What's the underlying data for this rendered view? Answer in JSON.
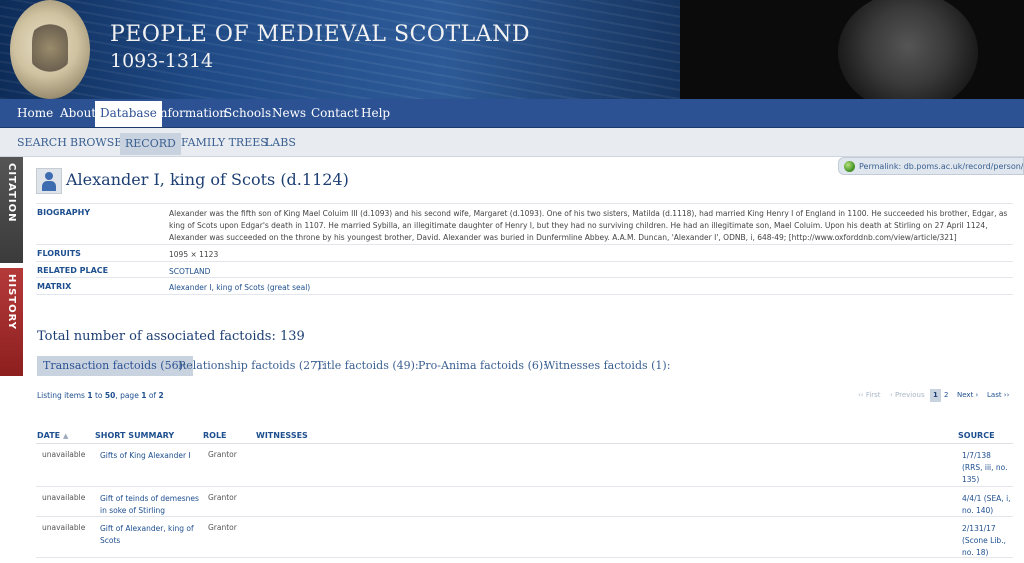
{
  "header": {
    "site_title": "PEOPLE OF MEDIEVAL SCOTLAND",
    "site_years": "1093-1314"
  },
  "main_nav": {
    "items": [
      "Home",
      "About",
      "Database",
      "Information",
      "Schools",
      "News",
      "Contact",
      "Help"
    ],
    "active": "Database"
  },
  "sub_nav": {
    "items": [
      "SEARCH",
      "BROWSE",
      "RECORD",
      "FAMILY TREES",
      "LABS"
    ],
    "active": "RECORD"
  },
  "side_tabs": {
    "citation": "CITATION",
    "history": "HISTORY"
  },
  "permalink": "Permalink: db.poms.ac.uk/record/person/265/",
  "record": {
    "title": "Alexander I, king of Scots (d.1124)",
    "fields": {
      "biography_label": "BIOGRAPHY",
      "biography": "Alexander was the fifth son of King Mael Coluim III (d.1093) and his second wife, Margaret (d.1093). One of his two sisters, Matilda (d.1118), had married King Henry I of England in 1100. He succeeded his brother, Edgar, as king of Scots upon Edgar's death in 1107. He married Sybilla, an illegitimate daughter of Henry I, but they had no surviving children. He had an illegitimate son, Mael Coluim. Upon his death at Stirling on 27 April 1124, Alexander was succeeded on the throne by his youngest brother, David. Alexander was buried in Dunfermline Abbey. A.A.M. Duncan, 'Alexander I', ODNB, i, 648-49; [http://www.oxforddnb.com/view/article/321]",
      "floruits_label": "FLORUITS",
      "floruits": "1095 × 1123",
      "related_place_label": "RELATED PLACE",
      "related_place": "SCOTLAND",
      "matrix_label": "MATRIX",
      "matrix": "Alexander I, king of Scots (great seal)"
    }
  },
  "factoids": {
    "total": "Total number of associated factoids: 139",
    "tabs": [
      "Transaction factoids (56):",
      "Relationship factoids (27):",
      "Title factoids (49):",
      "Pro-Anima factoids (6):",
      "Witnesses factoids (1):"
    ],
    "active_tab": "Transaction factoids (56):"
  },
  "listing": {
    "prefix": "Listing items",
    "from": "1",
    "to_word": "to",
    "to": "50",
    "page_word": ", page",
    "page": "1",
    "of_word": "of",
    "pages": "2"
  },
  "pager": {
    "first": "‹‹ First",
    "previous": "‹ Previous",
    "pages": [
      "1",
      "2"
    ],
    "current": "1",
    "next": "Next ›",
    "last": "Last ››"
  },
  "table": {
    "headers": {
      "date": "DATE",
      "summary": "SHORT SUMMARY",
      "role": "ROLE",
      "witnesses": "WITNESSES",
      "source": "SOURCE"
    },
    "rows": [
      {
        "date": "unavailable",
        "summary": "Gifts of King Alexander I",
        "role": "Grantor",
        "source": "1/7/138 (RRS, iii, no. 135)"
      },
      {
        "date": "unavailable",
        "summary": "Gift of teinds of demesnes in soke of Stirling",
        "role": "Grantor",
        "source": "4/4/1 (SEA, i, no. 140)"
      },
      {
        "date": "unavailable",
        "summary": "Gift of Alexander, king of Scots",
        "role": "Grantor",
        "source": "2/131/17 (Scone Lib., no. 18)"
      }
    ]
  },
  "colors": {
    "nav_blue": "#2d5294",
    "link_blue": "#1e4f8f",
    "history_red": "#8d1f1f",
    "citation_gray": "#3b3b3b"
  }
}
